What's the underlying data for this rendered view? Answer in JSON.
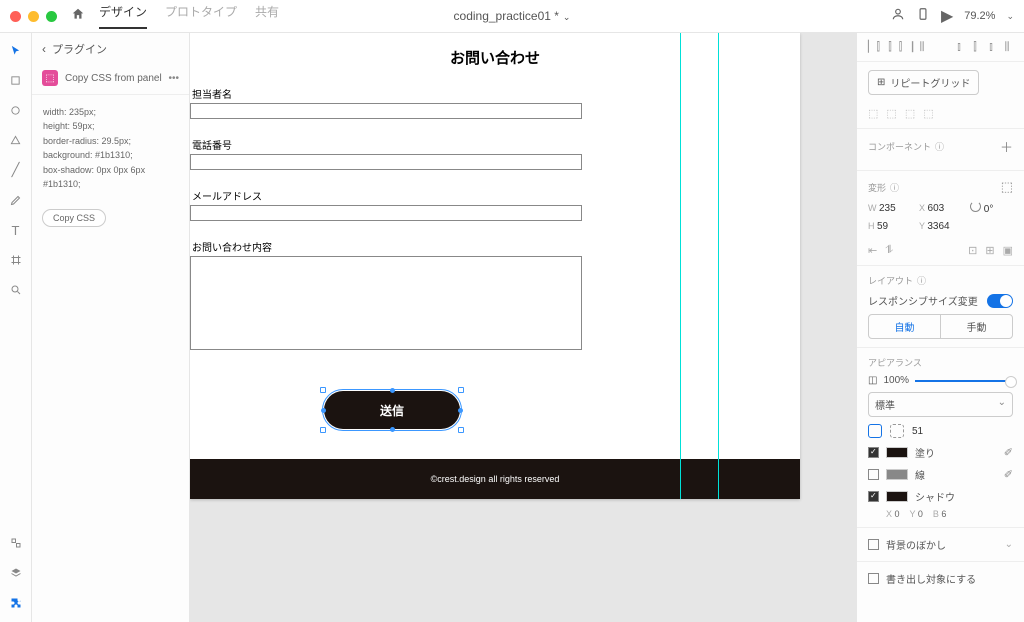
{
  "top": {
    "tabs": [
      "デザイン",
      "プロトタイプ",
      "共有"
    ],
    "title": "coding_practice01 *",
    "zoom": "79.2%"
  },
  "leftpanel": {
    "back_label": "プラグイン",
    "plugin_name": "Copy CSS from panel",
    "css_output": "width: 235px;\nheight: 59px;\nborder-radius: 29.5px;\nbackground: #1b1310;\nbox-shadow: 0px 0px 6px #1b1310;",
    "copy_btn": "Copy CSS"
  },
  "canvas": {
    "form_title": "お問い合わせ",
    "labels": {
      "name": "担当者名",
      "phone": "電話番号",
      "email": "メールアドレス",
      "content": "お問い合わせ内容"
    },
    "submit": "送信",
    "footer": "©crest.design all rights reserved"
  },
  "right": {
    "repeat_grid": "リピートグリッド",
    "component": "コンポーネント",
    "transform": "変形",
    "w": "235",
    "x": "603",
    "h": "59",
    "y": "3364",
    "rot": "0°",
    "layout": "レイアウト",
    "responsive": "レスポンシブサイズ変更",
    "auto": "自動",
    "manual": "手動",
    "appearance": "アピアランス",
    "opacity": "100%",
    "blend": "標準",
    "corner": "51",
    "fill": "塗り",
    "border": "線",
    "shadow": "シャドウ",
    "shadow_x": "0",
    "shadow_y": "0",
    "shadow_b": "6",
    "bg_blur": "背景のぼかし",
    "export": "書き出し対象にする"
  }
}
